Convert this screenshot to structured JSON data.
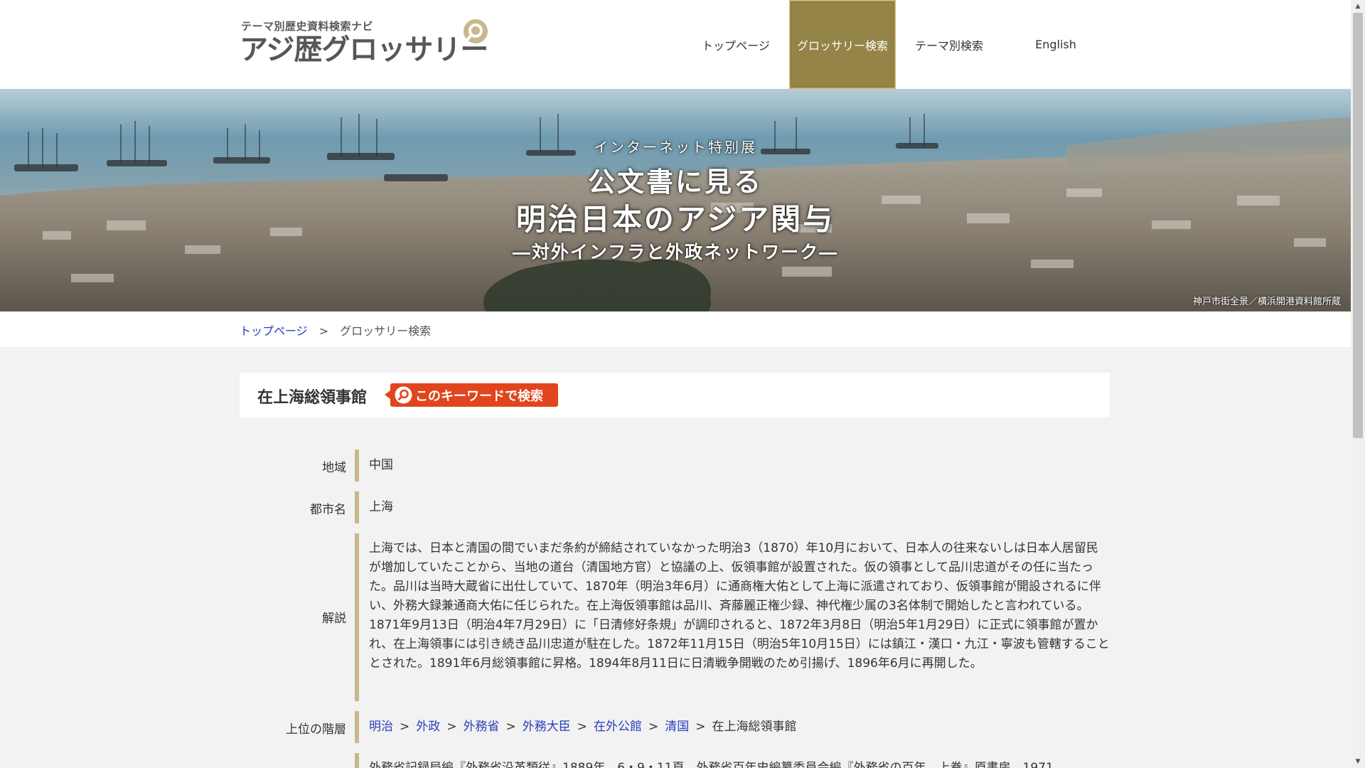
{
  "header": {
    "logo_sub": "テーマ別歴史資料検索ナビ",
    "logo_main": "アジ歴グロッサリー",
    "nav": [
      {
        "label": "トップページ",
        "active": false
      },
      {
        "label": "グロッサリー検索",
        "active": true
      },
      {
        "label": "テーマ別検索",
        "active": false
      },
      {
        "label": "English",
        "active": false
      }
    ]
  },
  "banner": {
    "line1": "インターネット特別展",
    "line2": "公文書に見る",
    "line3": "明治日本のアジア関与",
    "line4": "―対外インフラと外政ネットワーク―",
    "credit": "神戸市街全景／横浜開港資料館所蔵"
  },
  "breadcrumb": {
    "home": "トップページ",
    "separator": ">",
    "current": "グロッサリー検索"
  },
  "entry": {
    "title": "在上海総領事館",
    "search_button": "このキーワードで検索"
  },
  "details": {
    "region_label": "地域",
    "region_value": "中国",
    "city_label": "都市名",
    "city_value": "上海",
    "description_label": "解説",
    "description_value": "上海では、日本と清国の間でいまだ条約が締結されていなかった明治3（1870）年10月において、日本人の往来ないしは日本人居留民が増加していたことから、当地の道台（清国地方官）と協議の上、仮領事館が設置された。仮の領事として品川忠道がその任に当たった。品川は当時大蔵省に出仕していて、1870年（明治3年6月）に通商権大佑として上海に派遣されており、仮領事館が開設されるに伴い、外務大録兼通商大佑に任じられた。在上海仮領事館は品川、斉藤麗正権少録、神代権少属の3名体制で開始したと言われている。1871年9月13日（明治4年7月29日）に「日清修好条規」が調印されると、1872年3月8日（明治5年1月29日）に正式に領事館が置かれ、在上海領事には引き続き品川忠道が駐在した。1872年11月15日（明治5年10月15日）には鎮江・漢口・九江・寧波も管轄することとされた。1891年6月総領事館に昇格。1894年8月11日に日清戦争開戦のため引揚げ、1896年6月に再開した。",
    "hierarchy_label": "上位の階層",
    "hierarchy": [
      "明治",
      "外政",
      "外務省",
      "外務大臣",
      "在外公館",
      "清国"
    ],
    "hierarchy_separator": ">",
    "hierarchy_current": "在上海総領事館",
    "references_partial": "外務省記録局編『外務省沿革類従』1889年、6・9・11頁。外務省百年史編纂委員会編『外務省の百年　上巻』原書房、1971"
  },
  "colors": {
    "accent_gold": "#958447",
    "search_orange": "#e2451d",
    "link_blue": "#2a3ebb",
    "row_bar": "#c9b78c"
  },
  "icons": [
    "search-magnifier-icon",
    "scroll-up-arrow-icon",
    "scroll-down-arrow-icon"
  ]
}
